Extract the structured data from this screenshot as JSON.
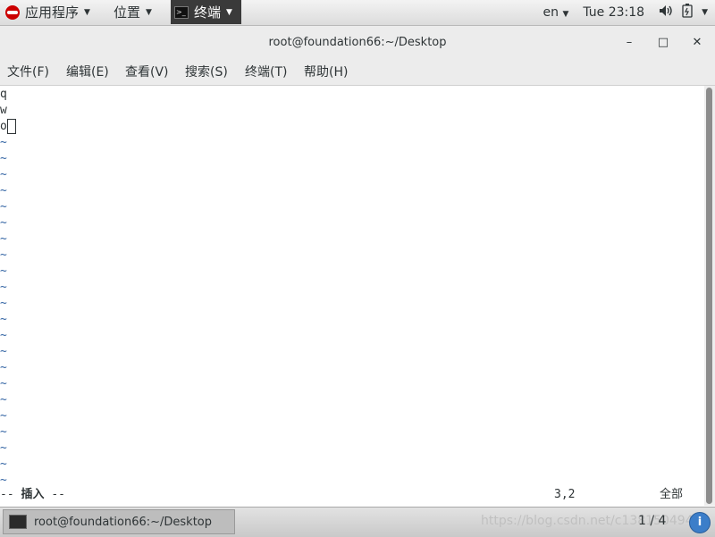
{
  "topbar": {
    "applications_label": "应用程序",
    "places_label": "位置",
    "terminal_label": "终端",
    "language": "en",
    "clock": "Tue 23:18"
  },
  "window": {
    "title": "root@foundation66:~/Desktop",
    "minimize": "–",
    "maximize": "□",
    "close": "✕"
  },
  "menubar": {
    "file": "文件(F)",
    "edit": "编辑(E)",
    "view": "查看(V)",
    "search": "搜索(S)",
    "terminal": "终端(T)",
    "help": "帮助(H)"
  },
  "terminal": {
    "lines": [
      "q",
      "w",
      "o"
    ],
    "tilde": "~",
    "status": {
      "mode_prefix": "-- ",
      "mode": "插入",
      "mode_suffix": " --",
      "position": "3,2",
      "scope": "全部"
    }
  },
  "taskbar": {
    "window_title": "root@foundation66:~/Desktop",
    "watermark": "https://blog.csdn.net/c1381504944",
    "pager": "1 / 4"
  },
  "icons": {
    "redhat": "redhat-logo-icon",
    "terminal": "terminal-icon",
    "volume": "volume-icon",
    "battery": "battery-icon",
    "info": "info-icon"
  },
  "colors": {
    "tilde": "#3465a4",
    "topbar": "#dcdcdc",
    "info": "#3c7ec9"
  }
}
